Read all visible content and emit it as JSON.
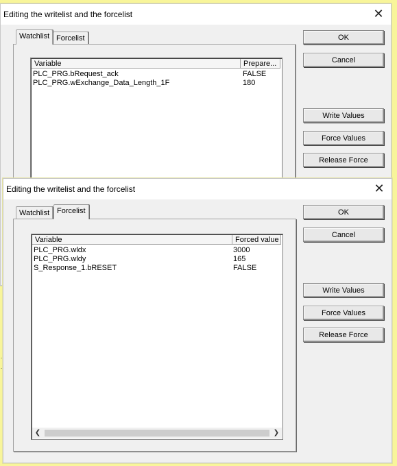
{
  "dialog1": {
    "title": "Editing the writelist and the forcelist",
    "tabs": [
      {
        "label": "Watchlist",
        "active": true
      },
      {
        "label": "Forcelist",
        "active": false
      }
    ],
    "columns": [
      "Variable",
      "Prepare..."
    ],
    "rows": [
      {
        "variable": "PLC_PRG.bRequest_ack",
        "value": "FALSE"
      },
      {
        "variable": "PLC_PRG.wExchange_Data_Length_1F",
        "value": "180"
      }
    ],
    "buttons": {
      "ok": "OK",
      "cancel": "Cancel",
      "write_values": "Write Values",
      "force_values": "Force Values",
      "release_force": "Release Force"
    }
  },
  "dialog2": {
    "title": "Editing the writelist and the forcelist",
    "tabs": [
      {
        "label": "Watchlist",
        "active": false
      },
      {
        "label": "Forcelist",
        "active": true
      }
    ],
    "columns": [
      "Variable",
      "Forced value"
    ],
    "rows": [
      {
        "variable": "PLC_PRG.wldx",
        "value": "3000"
      },
      {
        "variable": "PLC_PRG.wldy",
        "value": "165"
      },
      {
        "variable": "S_Response_1.bRESET",
        "value": "FALSE"
      }
    ],
    "buttons": {
      "ok": "OK",
      "cancel": "Cancel",
      "write_values": "Write Values",
      "force_values": "Force Values",
      "release_force": "Release Force"
    }
  },
  "icons": {
    "close": "close-icon",
    "scroll_left": "chevron-left-icon",
    "scroll_right": "chevron-right-icon"
  },
  "colors": {
    "desktop_background": "#F8F59A",
    "dialog_background": "#F0F0F0",
    "list_background": "#FFFFFF"
  }
}
